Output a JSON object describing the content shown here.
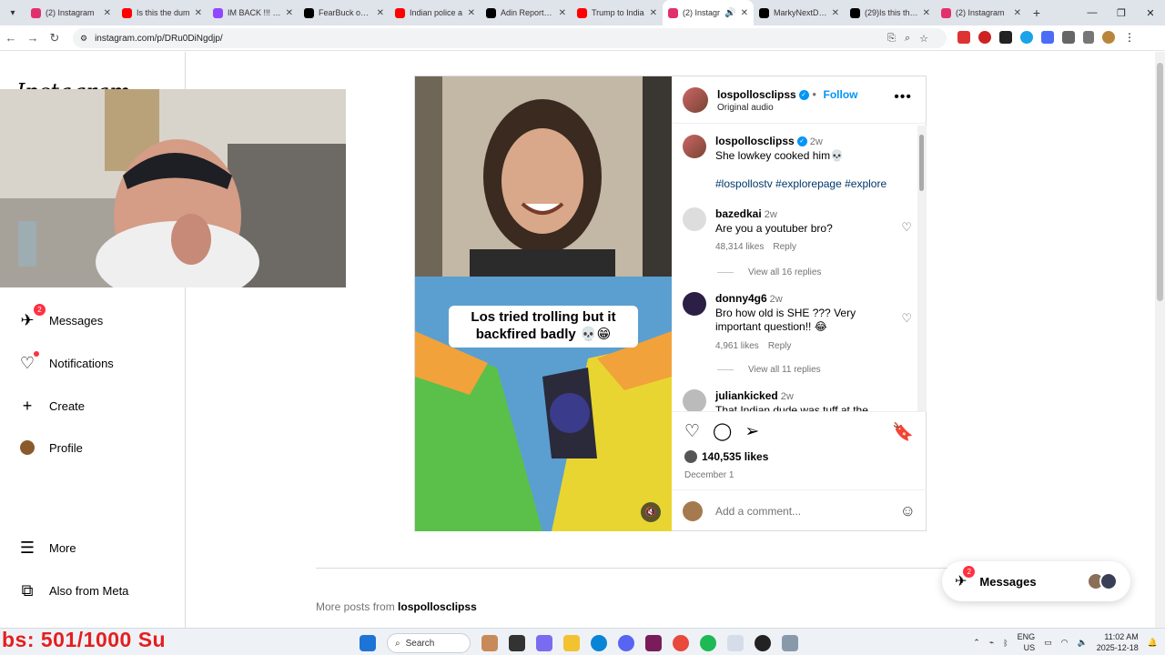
{
  "browser": {
    "tabs": [
      {
        "title": "(2) Instagram",
        "color": "#e1306c",
        "active": false
      },
      {
        "title": "Is this the dum",
        "color": "#ff0000",
        "active": false
      },
      {
        "title": "IM BACK !!! - Ti",
        "color": "#9146ff",
        "active": false
      },
      {
        "title": "FearBuck on X:",
        "color": "#000000",
        "active": false
      },
      {
        "title": "Indian police a",
        "color": "#ff0000",
        "active": false
      },
      {
        "title": "Adin Reports o",
        "color": "#000000",
        "active": false
      },
      {
        "title": "Trump to India",
        "color": "#ff0000",
        "active": false
      },
      {
        "title": "(2) Instagr",
        "color": "#e1306c",
        "active": true
      },
      {
        "title": "MarkyNextDoo",
        "color": "#000000",
        "active": false
      },
      {
        "title": "(29)Is this the c",
        "color": "#000000",
        "active": false
      },
      {
        "title": "(2) Instagram",
        "color": "#e1306c",
        "active": false
      }
    ],
    "url": "instagram.com/p/DRu0DiNgdjp/"
  },
  "sidebar": {
    "logo": "Instagram",
    "items": [
      {
        "label": "Messages",
        "badge": "2"
      },
      {
        "label": "Notifications"
      },
      {
        "label": "Create"
      },
      {
        "label": "Profile"
      },
      {
        "label": "More"
      },
      {
        "label": "Also from Meta"
      }
    ]
  },
  "video": {
    "caption": "Los tried trolling but it backfired badly 💀😁"
  },
  "post": {
    "author": "lospolloscIipss",
    "follow_label": "Follow",
    "audio": "Original audio",
    "caption_user": "lospolloscIipss",
    "caption_time": "2w",
    "caption_text": "She lowkey cooked him💀",
    "hashtags": "#lospollostv #explorepage #explore",
    "comments": [
      {
        "user": "bazedkai",
        "time": "2w",
        "text": "Are you a youtuber bro?",
        "likes": "48,314 likes",
        "reply": "Reply",
        "view_replies": "View all 16 replies"
      },
      {
        "user": "donny4g6",
        "time": "2w",
        "text": "Bro how old is SHE ??? Very important question!! 😂",
        "likes": "4,961 likes",
        "reply": "Reply",
        "view_replies": "View all 11 replies"
      },
      {
        "user": "juliankicked",
        "time": "2w",
        "text": "That Indian dude was tuff at the"
      }
    ],
    "like_count": "140,535 likes",
    "date": "December 1",
    "add_comment_placeholder": "Add a comment..."
  },
  "more_posts": {
    "prefix": "More posts from",
    "user": "lospolloscIipss"
  },
  "messages_float": {
    "label": "Messages",
    "badge": "2"
  },
  "overlay": {
    "text": "bs: 501/1000  Su"
  },
  "taskbar": {
    "search_label": "Search",
    "lang_top": "ENG",
    "lang_bottom": "US",
    "time": "11:02 AM",
    "date": "2025-12-18"
  }
}
